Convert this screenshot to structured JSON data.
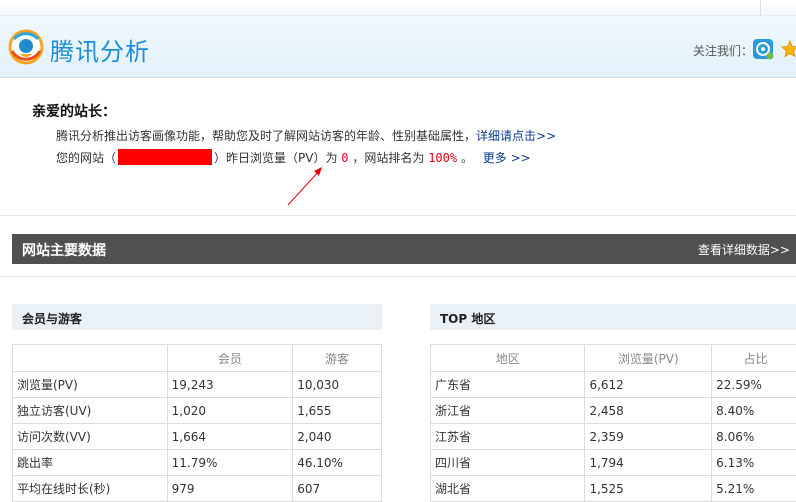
{
  "header": {
    "brand": "腾讯分析",
    "follow_label": "关注我们：",
    "icons": [
      "tencent-analytics-logo-icon",
      "weibo-icon",
      "star-icon"
    ]
  },
  "notice": {
    "greeting": "亲爱的站长：",
    "line1_text": "腾讯分析推出访客画像功能，帮助您及时了解网站访客的年龄、性别基础属性，",
    "line1_link": "详细请点击>>",
    "line2_prefix": "您的网站（",
    "line2_mid": "）昨日浏览量（PV）为",
    "pv_value": "0",
    "line2_rank_label": "，网站排名为",
    "rank_value": "100%",
    "line2_end": "。",
    "more_link": "更多 >>"
  },
  "section": {
    "title": "网站主要数据",
    "detail_link": "查看详细数据>>"
  },
  "members_panel": {
    "title": "会员与游客",
    "columns": [
      "",
      "会员",
      "游客"
    ],
    "rows": [
      [
        "浏览量(PV)",
        "19,243",
        "10,030"
      ],
      [
        "独立访客(UV)",
        "1,020",
        "1,655"
      ],
      [
        "访问次数(VV)",
        "1,664",
        "2,040"
      ],
      [
        "跳出率",
        "11.79%",
        "46.10%"
      ],
      [
        "平均在线时长(秒)",
        "979",
        "607"
      ]
    ]
  },
  "region_panel": {
    "title": "TOP 地区",
    "columns": [
      "地区",
      "浏览量(PV)",
      "占比"
    ],
    "rows": [
      [
        "广东省",
        "6,612",
        "22.59%"
      ],
      [
        "浙江省",
        "2,458",
        "8.40%"
      ],
      [
        "江苏省",
        "2,359",
        "8.06%"
      ],
      [
        "四川省",
        "1,794",
        "6.13%"
      ],
      [
        "湖北省",
        "1,525",
        "5.21%"
      ]
    ]
  },
  "colors": {
    "brand_blue": "#1a8fd8",
    "section_bar": "#505050",
    "highlight_red": "#e60012",
    "redaction": "#ff0000"
  }
}
